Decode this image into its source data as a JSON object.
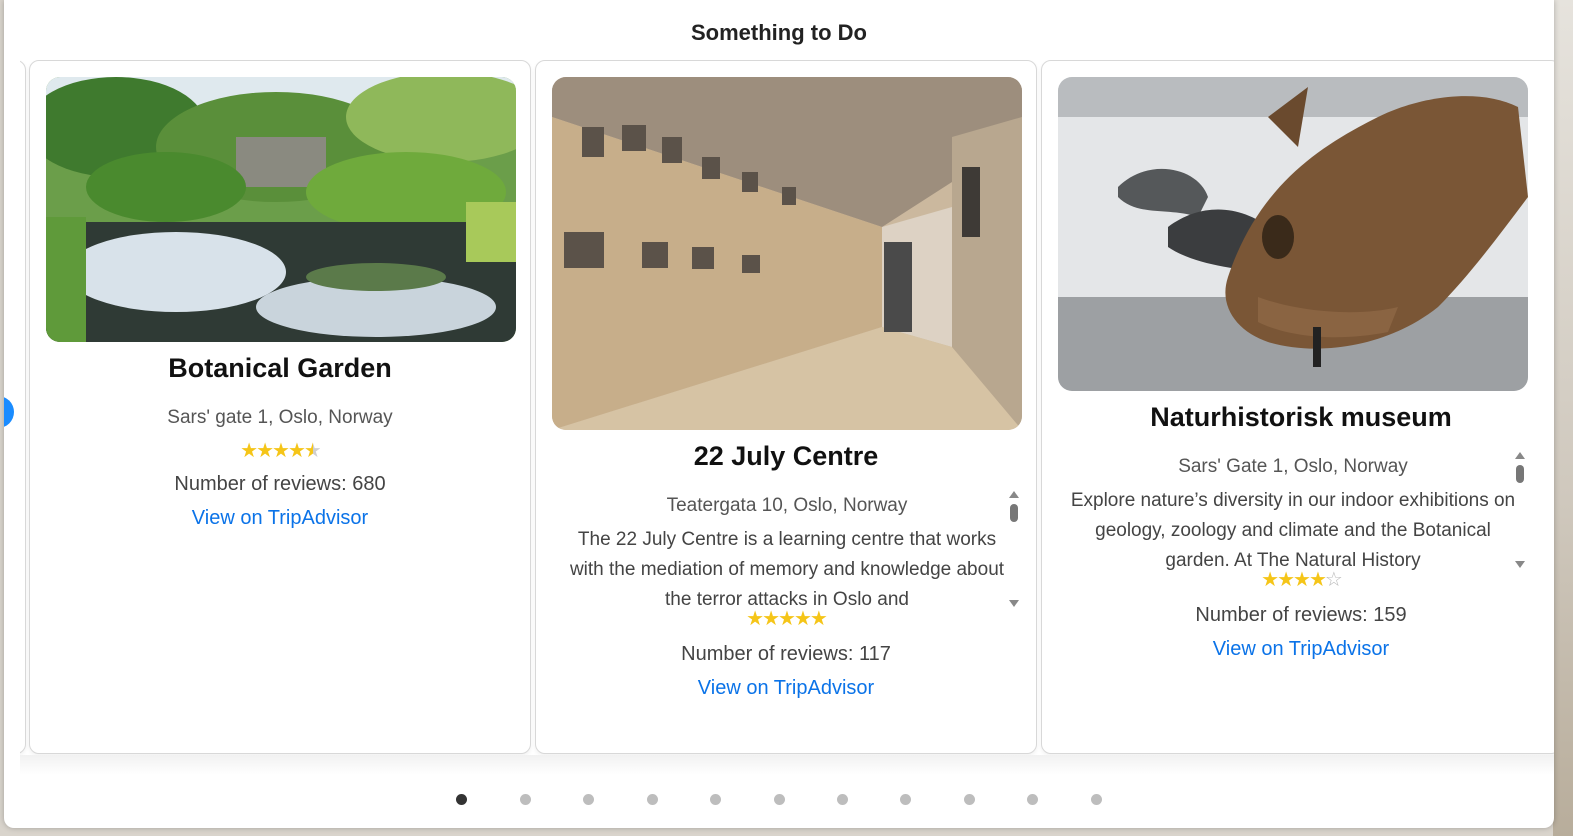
{
  "modal": {
    "title": "Something to Do"
  },
  "cards": [
    {
      "name": "Botanical Garden",
      "address": "Sars' gate 1, Oslo, Norway",
      "description": "",
      "rating_stars": 4.5,
      "reviews_label": "Number of reviews: 680",
      "link_label": "View on TripAdvisor"
    },
    {
      "name": "22 July Centre",
      "address": "Teatergata 10, Oslo, Norway",
      "description": "The 22 July Centre is a learning centre that works with the mediation of memory and knowledge about the terror attacks in Oslo and",
      "rating_stars": 5,
      "reviews_label": "Number of reviews: 117",
      "link_label": "View on TripAdvisor"
    },
    {
      "name": "Naturhistorisk museum",
      "address": "Sars' Gate 1, Oslo, Norway",
      "description": "Explore nature’s diversity in our indoor exhibitions on geology, zoology and climate and the Botanical garden. At The Natural History",
      "rating_stars": 4,
      "reviews_label": "Number of reviews: 159",
      "link_label": "View on TripAdvisor"
    }
  ],
  "carousel": {
    "prev_icon": "chevron-left-icon",
    "next_icon": "chevron-right-icon",
    "page_count": 11,
    "active_page": 1
  },
  "colors": {
    "accent": "#1a8cff",
    "link": "#0b73e8",
    "star": "#f5c518"
  }
}
